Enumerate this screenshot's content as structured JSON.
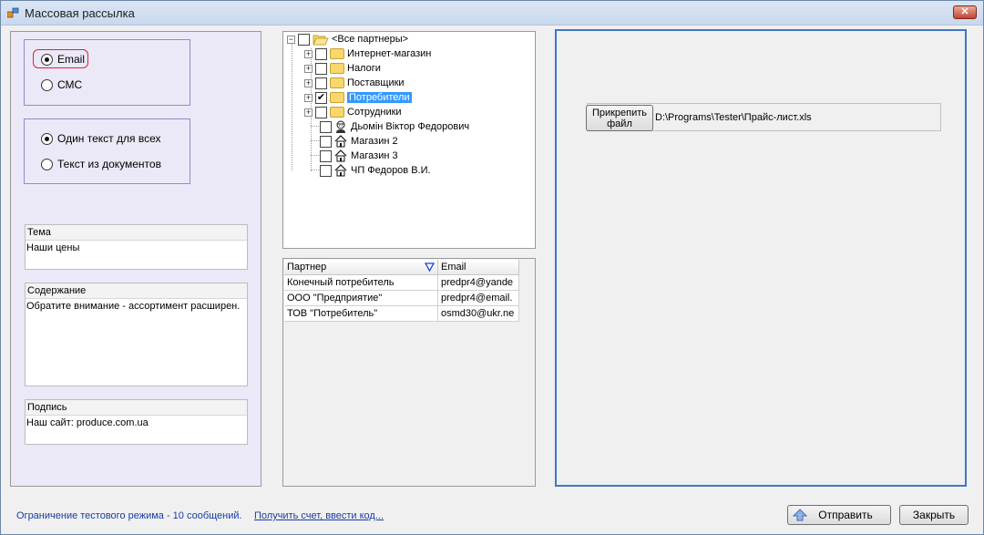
{
  "window": {
    "title": "Массовая рассылка",
    "close_glyph": "✕",
    "app_icon": "app-icon"
  },
  "left": {
    "channel": {
      "email": "Email",
      "sms": "СМС",
      "selected": "Email"
    },
    "text_mode": {
      "same": "Один текст для всех",
      "from_docs": "Текст из документов",
      "selected": "Один текст для всех"
    },
    "subject": {
      "label": "Тема",
      "value": "Наши цены"
    },
    "content": {
      "label": "Содержание",
      "value": "Обратите внимание - ассортимент расширен."
    },
    "signature": {
      "label": "Подпись",
      "value": "Наш сайт: produce.com.ua"
    }
  },
  "tree": {
    "root": "<Все партнеры>",
    "items": [
      {
        "label": "Интернет-магазин",
        "type": "folder",
        "checked": false
      },
      {
        "label": "Налоги",
        "type": "folder",
        "checked": false
      },
      {
        "label": "Поставщики",
        "type": "folder",
        "checked": false
      },
      {
        "label": "Потребители",
        "type": "folder",
        "checked": true,
        "selected": true
      },
      {
        "label": "Сотрудники",
        "type": "folder",
        "checked": false
      },
      {
        "label": "Дьомін Віктор Федорович",
        "type": "person",
        "checked": false
      },
      {
        "label": "Магазин 2",
        "type": "house",
        "checked": false
      },
      {
        "label": "Магазин 3",
        "type": "house",
        "checked": false
      },
      {
        "label": "ЧП Федоров В.И.",
        "type": "house",
        "checked": false
      }
    ],
    "check_glyph": "✔"
  },
  "grid": {
    "columns": [
      "Партнер",
      "Email"
    ],
    "rows": [
      [
        "Конечный потребитель",
        "predpr4@yande"
      ],
      [
        "ООО \"Предприятие\"",
        "predpr4@email."
      ],
      [
        "ТОВ \"Потребитель\"",
        "osmd30@ukr.ne"
      ]
    ]
  },
  "attachment": {
    "button": "Прикрепить\nфайл",
    "path": "D:\\Programs\\Tester\\Прайс-лист.xls"
  },
  "footer": {
    "status": "Ограничение тестового режима - 10 сообщений.",
    "link": "Получить счет, ввести код...",
    "send": "Отправить",
    "close": "Закрыть"
  },
  "colors": {
    "accent": "#3e78c4",
    "selection": "#3399ff",
    "link": "#1a3ca0",
    "highlight": "#e0203a",
    "panel": "#ebe9f7"
  }
}
